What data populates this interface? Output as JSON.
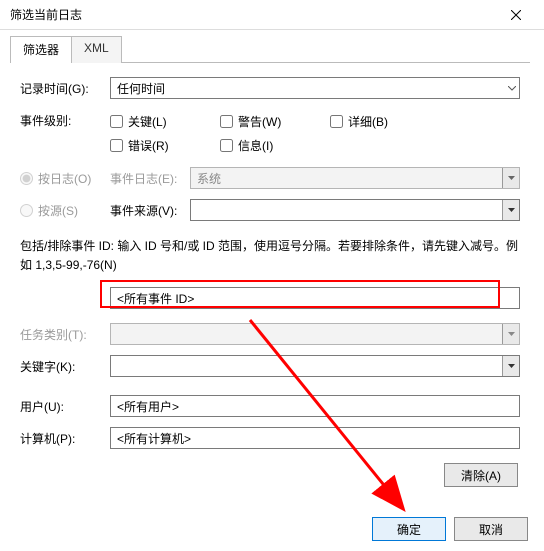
{
  "title": "筛选当前日志",
  "tabs": {
    "filter": "筛选器",
    "xml": "XML"
  },
  "labels": {
    "logTime": "记录时间(G):",
    "eventLevel": "事件级别:",
    "byLog": "按日志(O)",
    "bySource": "按源(S)",
    "eventLog": "事件日志(E):",
    "eventSource": "事件来源(V):",
    "taskCategory": "任务类别(T):",
    "keyword": "关键字(K):",
    "user": "用户(U):",
    "computer": "计算机(P):"
  },
  "values": {
    "logTime": "任何时间",
    "eventLog": "系统",
    "eventSource": "",
    "eventId": "<所有事件 ID>",
    "taskCategory": "",
    "keyword": "",
    "user": "<所有用户>",
    "computer": "<所有计算机>"
  },
  "checks": {
    "critical": "关键(L)",
    "warning": "警告(W)",
    "verbose": "详细(B)",
    "error": "错误(R)",
    "info": "信息(I)"
  },
  "helpText": "包括/排除事件 ID: 输入 ID 号和/或 ID 范围，使用逗号分隔。若要排除条件，请先键入减号。例如 1,3,5-99,-76(N)",
  "buttons": {
    "clear": "清除(A)",
    "ok": "确定",
    "cancel": "取消"
  }
}
